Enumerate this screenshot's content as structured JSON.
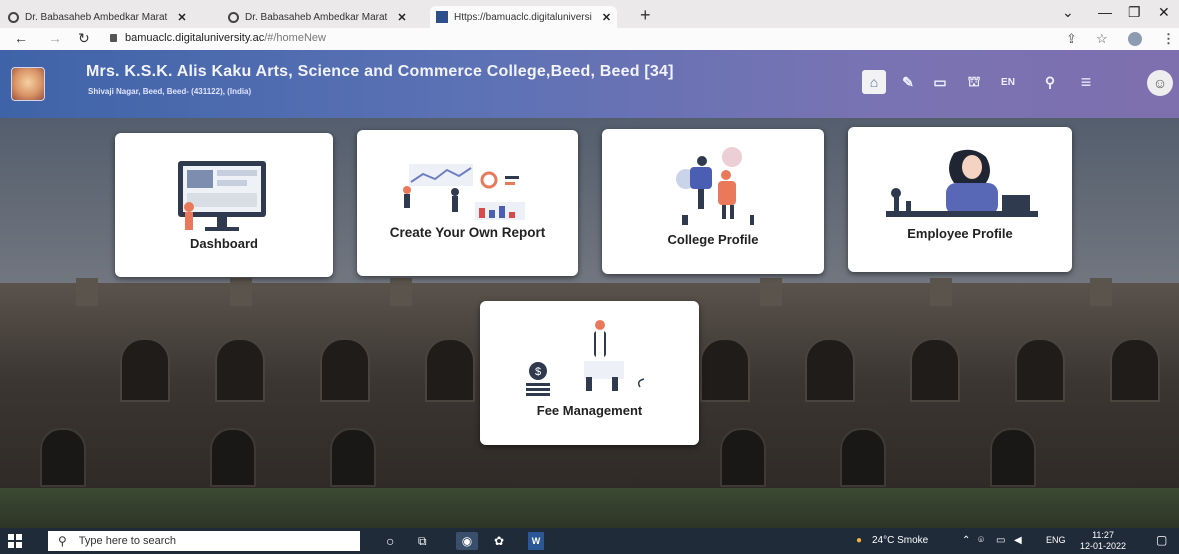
{
  "browser": {
    "tabs": [
      {
        "title": "Dr. Babasaheb Ambedkar Marat"
      },
      {
        "title": "Dr. Babasaheb Ambedkar Marat"
      },
      {
        "title": "Https://bamuaclc.digitaluniversi"
      }
    ],
    "new_tab": "+",
    "url_host": "bamuaclc.digitaluniversity.ac",
    "url_path": "/#/homeNew"
  },
  "header": {
    "college_name": "Mrs. K.S.K. Alis Kaku Arts, Science and Commerce College,Beed, Beed [34]",
    "address": "Shivaji Nagar, Beed, Beed- (431122), (India)",
    "lang_label": "EN"
  },
  "tiles": [
    {
      "label": "Dashboard"
    },
    {
      "label": "Create Your Own Report"
    },
    {
      "label": "College Profile"
    },
    {
      "label": "Employee Profile"
    },
    {
      "label": "Fee Management"
    }
  ],
  "taskbar": {
    "search_placeholder": "Type here to search",
    "weather": "24°C  Smoke",
    "lang": "ENG",
    "time": "11:27",
    "date": "12-01-2022"
  },
  "icons": [
    "home-icon",
    "graduation-cap-icon",
    "id-card-icon",
    "bank-icon",
    "search-icon",
    "menu-icon",
    "user-avatar-icon",
    "share-icon",
    "star-icon",
    "profile-icon",
    "kebab-menu-icon",
    "windows-start-icon",
    "task-view-icon",
    "notification-icon"
  ],
  "colors": {
    "header_start": "#3f63a8",
    "header_end": "#7e6fae",
    "taskbar": "#202b3a",
    "tile_bg": "#ffffff"
  }
}
